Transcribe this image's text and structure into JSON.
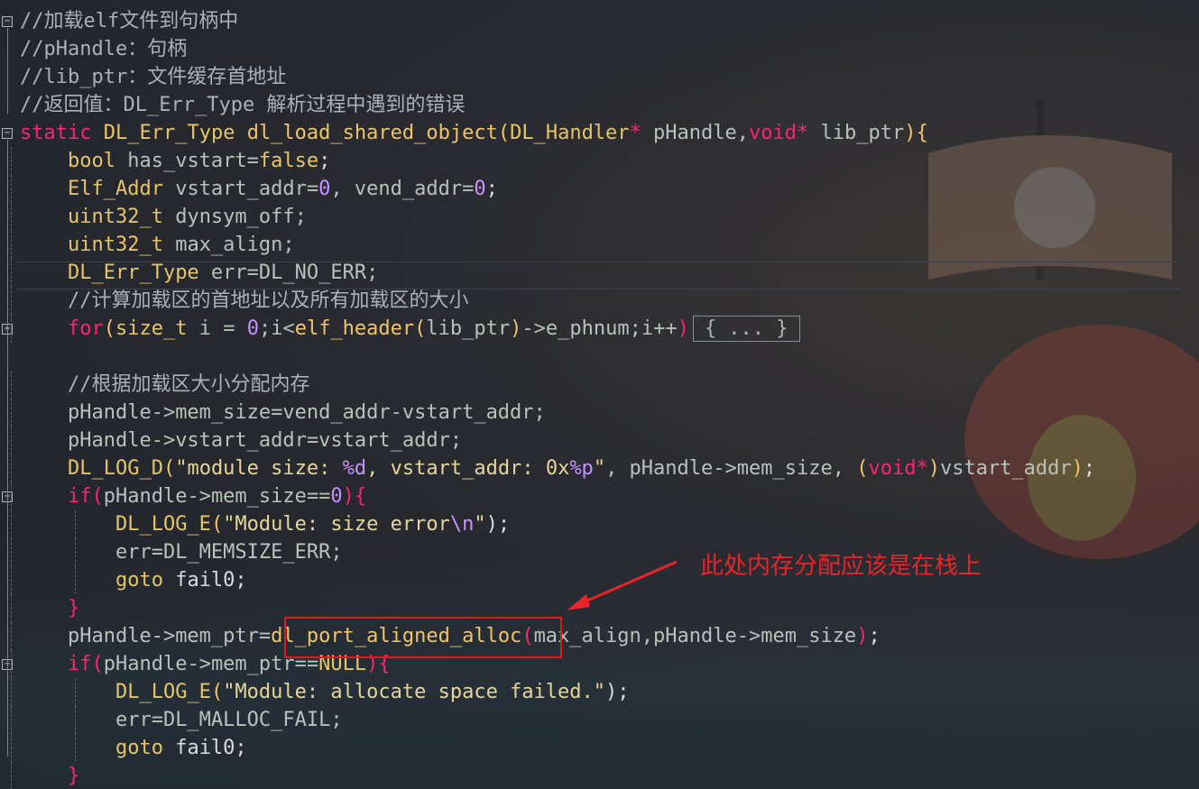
{
  "lines": [
    {
      "segs": [
        {
          "t": "//加载elf文件到句柄中",
          "c": "cm"
        }
      ]
    },
    {
      "segs": [
        {
          "t": "//pHandle：句柄",
          "c": "cm"
        }
      ]
    },
    {
      "segs": [
        {
          "t": "//lib_ptr：文件缓存首地址",
          "c": "cm"
        }
      ]
    },
    {
      "segs": [
        {
          "t": "//返回值：DL_Err_Type 解析过程中遇到的错误",
          "c": "cm"
        }
      ]
    },
    {
      "segs": [
        {
          "t": "static",
          "c": "kw"
        },
        {
          "t": " ",
          "c": "pu"
        },
        {
          "t": "DL_Err_Type",
          "c": "ty"
        },
        {
          "t": " ",
          "c": "pu"
        },
        {
          "t": "dl_load_shared_object",
          "c": "fn"
        },
        {
          "t": "(",
          "c": "fn"
        },
        {
          "t": "DL_Handler",
          "c": "ty"
        },
        {
          "t": "*",
          "c": "kw"
        },
        {
          "t": " pHandle,",
          "c": "id"
        },
        {
          "t": "void",
          "c": "kw"
        },
        {
          "t": "*",
          "c": "kw"
        },
        {
          "t": " lib_ptr",
          "c": "id"
        },
        {
          "t": "){",
          "c": "fn"
        }
      ]
    },
    {
      "indent": "    ",
      "segs": [
        {
          "t": "bool",
          "c": "ty"
        },
        {
          "t": " has_vstart=",
          "c": "id"
        },
        {
          "t": "false",
          "c": "ty"
        },
        {
          "t": ";",
          "c": "pu"
        }
      ]
    },
    {
      "indent": "    ",
      "segs": [
        {
          "t": "Elf_Addr",
          "c": "ty"
        },
        {
          "t": " vstart_addr=",
          "c": "id"
        },
        {
          "t": "0",
          "c": "num"
        },
        {
          "t": ", vend_addr=",
          "c": "id"
        },
        {
          "t": "0",
          "c": "num"
        },
        {
          "t": ";",
          "c": "pu"
        }
      ]
    },
    {
      "indent": "    ",
      "segs": [
        {
          "t": "uint32_t",
          "c": "ty"
        },
        {
          "t": " dynsym_off;",
          "c": "id"
        }
      ]
    },
    {
      "indent": "    ",
      "segs": [
        {
          "t": "uint32_t",
          "c": "ty"
        },
        {
          "t": " max_align;",
          "c": "id"
        }
      ]
    },
    {
      "indent": "    ",
      "segs": [
        {
          "t": "DL_Err_Type",
          "c": "ty"
        },
        {
          "t": " err=DL_NO_ERR;",
          "c": "id"
        }
      ]
    },
    {
      "indent": "    ",
      "segs": [
        {
          "t": "//计算加载区的首地址以及所有加载区的大小",
          "c": "cm"
        }
      ]
    },
    {
      "indent": "    ",
      "segs": [
        {
          "t": "for",
          "c": "kw"
        },
        {
          "t": "(",
          "c": "pr"
        },
        {
          "t": "size_t",
          "c": "ty"
        },
        {
          "t": " i = ",
          "c": "id"
        },
        {
          "t": "0",
          "c": "num"
        },
        {
          "t": ";i<",
          "c": "id"
        },
        {
          "t": "elf_header",
          "c": "fn"
        },
        {
          "t": "(",
          "c": "pr"
        },
        {
          "t": "lib_ptr",
          "c": "id"
        },
        {
          "t": ")",
          "c": "pr"
        },
        {
          "t": "->e_phnum;i++",
          "c": "id"
        },
        {
          "t": ")",
          "c": "kw"
        }
      ],
      "folded": "{ ... }"
    },
    {
      "segs": []
    },
    {
      "indent": "    ",
      "segs": [
        {
          "t": "//根据加载区大小分配内存",
          "c": "cm"
        }
      ]
    },
    {
      "indent": "    ",
      "segs": [
        {
          "t": "pHandle->mem_size=vend_addr-vstart_addr;",
          "c": "id"
        }
      ]
    },
    {
      "indent": "    ",
      "segs": [
        {
          "t": "pHandle->vstart_addr=vstart_addr;",
          "c": "id"
        }
      ]
    },
    {
      "indent": "    ",
      "segs": [
        {
          "t": "DL_LOG_D",
          "c": "mac"
        },
        {
          "t": "(",
          "c": "pr"
        },
        {
          "t": "\"module size: ",
          "c": "str"
        },
        {
          "t": "%d",
          "c": "esc"
        },
        {
          "t": ", vstart_addr: 0x",
          "c": "str"
        },
        {
          "t": "%p",
          "c": "esc"
        },
        {
          "t": "\"",
          "c": "str"
        },
        {
          "t": ", pHandle->mem_size, ",
          "c": "id"
        },
        {
          "t": "(",
          "c": "pr"
        },
        {
          "t": "void",
          "c": "kw"
        },
        {
          "t": "*",
          "c": "kw"
        },
        {
          "t": ")",
          "c": "pr"
        },
        {
          "t": "vstart_addr",
          "c": "id"
        },
        {
          "t": ")",
          "c": "pr"
        },
        {
          "t": ";",
          "c": "pu"
        }
      ]
    },
    {
      "indent": "    ",
      "segs": [
        {
          "t": "if",
          "c": "kw"
        },
        {
          "t": "(",
          "c": "kw"
        },
        {
          "t": "pHandle->mem_size==",
          "c": "id"
        },
        {
          "t": "0",
          "c": "num"
        },
        {
          "t": "){",
          "c": "kw"
        }
      ]
    },
    {
      "indent": "        ",
      "segs": [
        {
          "t": "DL_LOG_E",
          "c": "mac"
        },
        {
          "t": "(",
          "c": "pr"
        },
        {
          "t": "\"Module: size error",
          "c": "str"
        },
        {
          "t": "\\n",
          "c": "esc"
        },
        {
          "t": "\"",
          "c": "str"
        },
        {
          "t": ");",
          "c": "pu"
        }
      ]
    },
    {
      "indent": "        ",
      "segs": [
        {
          "t": "err=DL_MEMSIZE_ERR;",
          "c": "id"
        }
      ]
    },
    {
      "indent": "        ",
      "segs": [
        {
          "t": "goto",
          "c": "ty"
        },
        {
          "t": " fail0;",
          "c": "pu"
        }
      ]
    },
    {
      "indent": "    ",
      "segs": [
        {
          "t": "}",
          "c": "kw"
        }
      ]
    },
    {
      "indent": "    ",
      "segs": [
        {
          "t": "pHandle->mem_ptr=",
          "c": "id"
        },
        {
          "t": "dl_port_aligned_alloc",
          "c": "fn"
        },
        {
          "t": "(",
          "c": "kw"
        },
        {
          "t": "max_align,pHandle->mem_size",
          "c": "id"
        },
        {
          "t": ")",
          "c": "kw"
        },
        {
          "t": ";",
          "c": "pu"
        }
      ]
    },
    {
      "indent": "    ",
      "segs": [
        {
          "t": "if",
          "c": "kw"
        },
        {
          "t": "(",
          "c": "kw"
        },
        {
          "t": "pHandle->mem_ptr==",
          "c": "id"
        },
        {
          "t": "NULL",
          "c": "ty"
        },
        {
          "t": "){",
          "c": "kw"
        }
      ]
    },
    {
      "indent": "        ",
      "segs": [
        {
          "t": "DL_LOG_E",
          "c": "mac"
        },
        {
          "t": "(",
          "c": "pr"
        },
        {
          "t": "\"Module: allocate space failed.\"",
          "c": "str"
        },
        {
          "t": ");",
          "c": "pu"
        }
      ]
    },
    {
      "indent": "        ",
      "segs": [
        {
          "t": "err=DL_MALLOC_FAIL;",
          "c": "id"
        }
      ]
    },
    {
      "indent": "        ",
      "segs": [
        {
          "t": "goto",
          "c": "ty"
        },
        {
          "t": " fail0;",
          "c": "pu"
        }
      ]
    },
    {
      "indent": "    ",
      "segs": [
        {
          "t": "}",
          "c": "kw"
        }
      ]
    }
  ],
  "folds": [
    {
      "line": 0,
      "sym": "−"
    },
    {
      "line": 4,
      "sym": "−"
    },
    {
      "line": 11,
      "sym": "+"
    },
    {
      "line": 17,
      "sym": "−"
    },
    {
      "line": 23,
      "sym": "−"
    }
  ],
  "annotation": {
    "text": "此处内存分配应该是在栈上",
    "color": "#e8242a"
  }
}
